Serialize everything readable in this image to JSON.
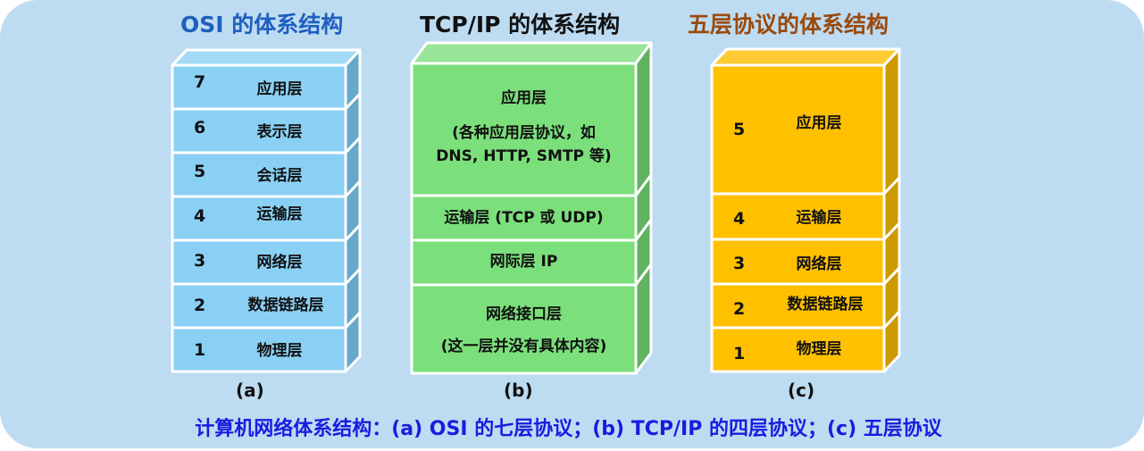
{
  "colors": {
    "background": "#bddcf2",
    "osi_title": "#1f5fbf",
    "tcpip_title": "#111111",
    "five_title": "#9a4a0e",
    "caption": "#1b1be0",
    "osi_front": "#8ad0f4",
    "osi_top": "#a3daf6",
    "osi_side": "#66a8c8",
    "tcpip_front": "#7bdf7b",
    "tcpip_top": "#98e498",
    "tcpip_side": "#61b261",
    "five_front": "#ffc000",
    "five_top": "#ffcb33",
    "five_side": "#cc9a00",
    "edge": "#ffffff"
  },
  "osi": {
    "title": "OSI 的体系结构",
    "sublabel": "(a)",
    "layers": [
      {
        "num": "7",
        "label": "应用层"
      },
      {
        "num": "6",
        "label": "表示层"
      },
      {
        "num": "5",
        "label": "会话层"
      },
      {
        "num": "4",
        "label": "运输层"
      },
      {
        "num": "3",
        "label": "网络层"
      },
      {
        "num": "2",
        "label": "数据链路层"
      },
      {
        "num": "1",
        "label": "物理层"
      }
    ]
  },
  "tcpip": {
    "title": "TCP/IP 的体系结构",
    "sublabel": "(b)",
    "layers": [
      {
        "label": "应用层",
        "detail_1": "(各种应用层协议，如",
        "detail_2": "DNS, HTTP, SMTP 等)"
      },
      {
        "label": "运输层 (TCP 或 UDP)"
      },
      {
        "label": "网际层 IP"
      },
      {
        "label": "网络接口层",
        "detail_1": "(这一层并没有具体内容)"
      }
    ]
  },
  "five": {
    "title": "五层协议的体系结构",
    "sublabel": "(c)",
    "layers": [
      {
        "num": "5",
        "label": "应用层"
      },
      {
        "num": "4",
        "label": "运输层"
      },
      {
        "num": "3",
        "label": "网络层"
      },
      {
        "num": "2",
        "label": "数据链路层"
      },
      {
        "num": "1",
        "label": "物理层"
      }
    ]
  },
  "caption": "计算机网络体系结构：(a) OSI 的七层协议；(b) TCP/IP 的四层协议；(c) 五层协议"
}
